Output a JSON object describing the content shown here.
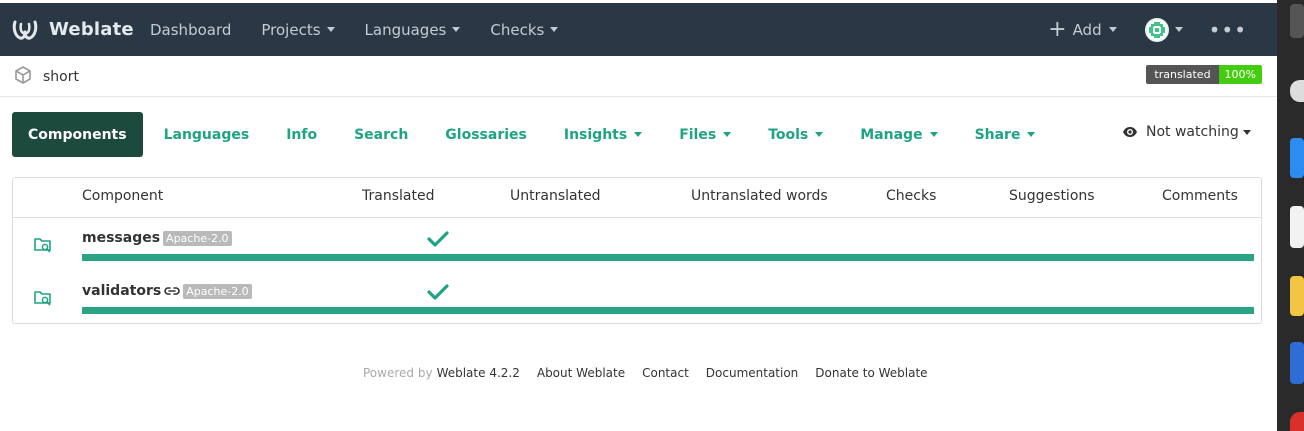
{
  "navbar": {
    "brand": "Weblate",
    "items": [
      {
        "label": "Dashboard",
        "dropdown": false
      },
      {
        "label": "Projects",
        "dropdown": true
      },
      {
        "label": "Languages",
        "dropdown": true
      },
      {
        "label": "Checks",
        "dropdown": true
      }
    ],
    "add_label": "Add",
    "more_icon": "ellipsis-icon"
  },
  "breadcrumb": {
    "icon": "cube-icon",
    "label": "short"
  },
  "status_badge": {
    "label": "translated",
    "value": "100%",
    "label_color": "#555555",
    "value_color": "#44cc11"
  },
  "tabs": [
    {
      "label": "Components",
      "active": true,
      "dropdown": false
    },
    {
      "label": "Languages",
      "active": false,
      "dropdown": false
    },
    {
      "label": "Info",
      "active": false,
      "dropdown": false
    },
    {
      "label": "Search",
      "active": false,
      "dropdown": false
    },
    {
      "label": "Glossaries",
      "active": false,
      "dropdown": false
    },
    {
      "label": "Insights",
      "active": false,
      "dropdown": true
    },
    {
      "label": "Files",
      "active": false,
      "dropdown": true
    },
    {
      "label": "Tools",
      "active": false,
      "dropdown": true
    },
    {
      "label": "Manage",
      "active": false,
      "dropdown": true
    },
    {
      "label": "Share",
      "active": false,
      "dropdown": true
    }
  ],
  "watch": {
    "label": "Not watching",
    "icon": "eye-icon"
  },
  "table": {
    "columns": [
      "Component",
      "Translated",
      "Untranslated",
      "Untranslated words",
      "Checks",
      "Suggestions",
      "Comments"
    ],
    "rows": [
      {
        "name": "messages",
        "license": "Apache-2.0",
        "linked": false,
        "translated_percent": 100
      },
      {
        "name": "validators",
        "license": "Apache-2.0",
        "linked": true,
        "translated_percent": 100
      }
    ]
  },
  "footer": {
    "powered_by": "Powered by",
    "version_link": "Weblate 4.2.2",
    "links": [
      "About Weblate",
      "Contact",
      "Documentation",
      "Donate to Weblate"
    ]
  },
  "colors": {
    "navbar_bg": "#2a3744",
    "accent": "#1fa385",
    "active_tab_bg": "#1c4a3d",
    "progress": "#2aa385"
  }
}
